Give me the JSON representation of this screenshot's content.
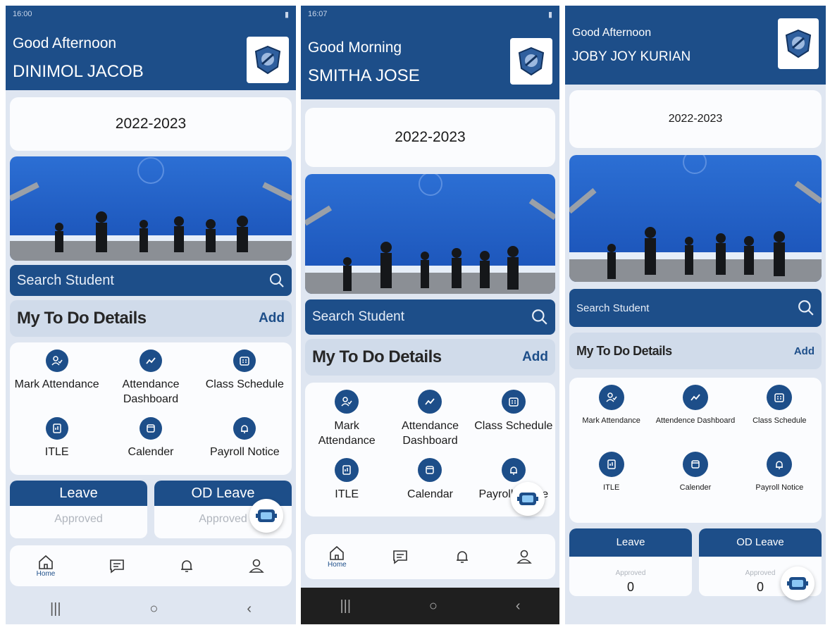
{
  "phones": [
    {
      "status_time": "16:00",
      "greeting": "Good Afternoon",
      "user_name": "DINIMOL JACOB",
      "academic_year": "2022-2023",
      "search_placeholder": "Search Student",
      "todo_title": "My To Do Details",
      "todo_add": "Add",
      "tiles": [
        {
          "label": "Mark Attendance",
          "icon": "user-check-icon"
        },
        {
          "label": "Attendance Dashboard",
          "icon": "trend-icon"
        },
        {
          "label": "Class Schedule",
          "icon": "calendar-grid-icon"
        },
        {
          "label": "ITLE",
          "icon": "tablet-icon"
        },
        {
          "label": "Calender",
          "icon": "calendar-icon"
        },
        {
          "label": "Payroll Notice",
          "icon": "bell-icon"
        }
      ],
      "leave_cards": [
        {
          "title": "Leave",
          "status": "Approved"
        },
        {
          "title": "OD Leave",
          "status": "Approved"
        }
      ],
      "nav": {
        "home_label": "Home"
      }
    },
    {
      "status_time": "16:07",
      "greeting": "Good Morning",
      "user_name": "SMITHA JOSE",
      "academic_year": "2022-2023",
      "search_placeholder": "Search Student",
      "todo_title": "My To Do Details",
      "todo_add": "Add",
      "tiles": [
        {
          "label": "Mark Attendance",
          "icon": "user-check-icon"
        },
        {
          "label": "Attendance Dashboard",
          "icon": "trend-icon"
        },
        {
          "label": "Class Schedule",
          "icon": "calendar-grid-icon"
        },
        {
          "label": "ITLE",
          "icon": "tablet-icon"
        },
        {
          "label": "Calendar",
          "icon": "calendar-icon"
        },
        {
          "label": "Payroll Notice",
          "icon": "bell-icon"
        }
      ],
      "nav": {
        "home_label": "Home"
      }
    },
    {
      "greeting": "Good Afternoon",
      "user_name": "JOBY JOY KURIAN",
      "academic_year": "2022-2023",
      "search_placeholder": "Search Student",
      "todo_title": "My To Do Details",
      "todo_add": "Add",
      "tiles": [
        {
          "label": "Mark Attendance",
          "icon": "user-check-icon"
        },
        {
          "label": "Attendence Dashboard",
          "icon": "trend-icon"
        },
        {
          "label": "Class Schedule",
          "icon": "calendar-grid-icon"
        },
        {
          "label": "ITLE",
          "icon": "tablet-icon"
        },
        {
          "label": "Calender",
          "icon": "calendar-icon"
        },
        {
          "label": "Payroll Notice",
          "icon": "bell-icon"
        }
      ],
      "leave_cards": [
        {
          "title": "Leave",
          "status": "Approved",
          "count": "0"
        },
        {
          "title": "OD Leave",
          "status": "Approved",
          "count": "0"
        }
      ]
    }
  ],
  "colors": {
    "primary": "#1d4e89",
    "background": "#dfe6f1",
    "card": "#fbfcfe"
  }
}
